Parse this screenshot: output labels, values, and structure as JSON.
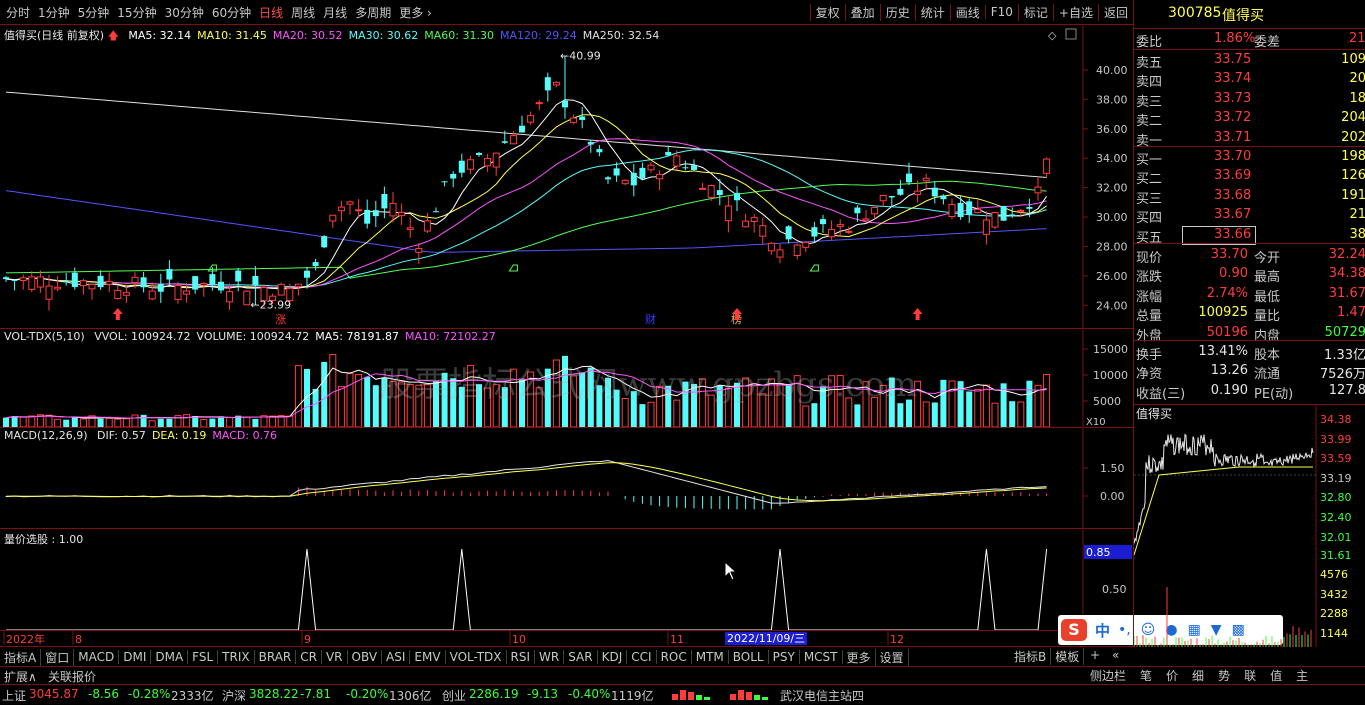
{
  "toolbar": {
    "periods": [
      "分时",
      "1分钟",
      "5分钟",
      "15分钟",
      "30分钟",
      "60分钟",
      "日线",
      "周线",
      "月线",
      "多周期",
      "更多"
    ],
    "active_period": "日线",
    "right_buttons": [
      "复权",
      "叠加",
      "历史",
      "统计",
      "画线",
      "F10",
      "标记",
      "+自选",
      "返回"
    ]
  },
  "main_chart": {
    "title": "值得买(日线 前复权)",
    "ma_labels": [
      {
        "text": "MA5: 32.14",
        "color": "#ffffff"
      },
      {
        "text": "MA10: 31.45",
        "color": "#ffff54"
      },
      {
        "text": "MA20: 30.52",
        "color": "#ff54ff"
      },
      {
        "text": "MA30: 30.62",
        "color": "#54fcfc"
      },
      {
        "text": "MA60: 31.30",
        "color": "#54fc54"
      },
      {
        "text": "MA120: 29.24",
        "color": "#5454fc"
      },
      {
        "text": "MA250: 32.54",
        "color": "#e0e0e0"
      }
    ],
    "y_ticks": [
      "40.00",
      "38.00",
      "36.00",
      "34.00",
      "32.00",
      "30.00",
      "28.00",
      "26.00",
      "24.00"
    ],
    "high_label": "40.99",
    "low_label": "23.99",
    "markers": [
      "涨",
      "财",
      "榜"
    ]
  },
  "vol_panel": {
    "title": "VOL-TDX(5,10)",
    "labels": [
      {
        "text": "VVOL: 100924.72",
        "color": "#e6e6e6"
      },
      {
        "text": "VOLUME: 100924.72",
        "color": "#e6e6e6"
      },
      {
        "text": "MA5: 78191.87",
        "color": "#ffffff"
      },
      {
        "text": "MA10: 72102.27",
        "color": "#ff54ff"
      }
    ],
    "y_ticks": [
      "15000",
      "10000",
      "5000"
    ],
    "unit": "X10"
  },
  "macd_panel": {
    "title": "MACD(12,26,9)",
    "labels": [
      {
        "text": "DIF: 0.57",
        "color": "#e6e6e6"
      },
      {
        "text": "DEA: 0.19",
        "color": "#ffff54"
      },
      {
        "text": "MACD: 0.76",
        "color": "#ff54ff"
      }
    ],
    "y_ticks": [
      "1.50",
      "0.00"
    ]
  },
  "select_panel": {
    "title": "量价选股 : 1.00",
    "y_ticks": [
      "0.85",
      "0.50"
    ]
  },
  "x_axis": {
    "labels": [
      "2022年",
      "8",
      "9",
      "10",
      "11",
      "12"
    ],
    "cursor_label": "2022/11/09/三"
  },
  "watermark": "股票指标公式网www.gpzbgs.com",
  "quote": {
    "code": "300785",
    "name": "值得买",
    "weibi_label": "委比",
    "weibi": "1.86%",
    "weicha_label": "委差",
    "weicha": "21",
    "sells": [
      {
        "label": "卖五",
        "price": "33.75",
        "vol": "109"
      },
      {
        "label": "卖四",
        "price": "33.74",
        "vol": "20"
      },
      {
        "label": "卖三",
        "price": "33.73",
        "vol": "18"
      },
      {
        "label": "卖二",
        "price": "33.72",
        "vol": "204"
      },
      {
        "label": "卖一",
        "price": "33.71",
        "vol": "202"
      }
    ],
    "buys": [
      {
        "label": "买一",
        "price": "33.70",
        "vol": "198"
      },
      {
        "label": "买二",
        "price": "33.69",
        "vol": "126"
      },
      {
        "label": "买三",
        "price": "33.68",
        "vol": "191"
      },
      {
        "label": "买四",
        "price": "33.67",
        "vol": "21"
      },
      {
        "label": "买五",
        "price": "33.66",
        "vol": "38"
      }
    ],
    "stats": [
      {
        "l1": "现价",
        "v1": "33.70",
        "l2": "今开",
        "v2": "32.24"
      },
      {
        "l1": "涨跌",
        "v1": "0.90",
        "l2": "最高",
        "v2": "34.38"
      },
      {
        "l1": "涨幅",
        "v1": "2.74%",
        "l2": "最低",
        "v2": "31.67"
      },
      {
        "l1": "总量",
        "v1": "100925",
        "l2": "量比",
        "v2": "1.47"
      },
      {
        "l1": "外盘",
        "v1": "50196",
        "l2": "内盘",
        "v2": "50729"
      }
    ],
    "stats2": [
      {
        "l1": "换手",
        "v1": "13.41%",
        "l2": "股本",
        "v2": "1.33亿"
      },
      {
        "l1": "净资",
        "v1": "13.26",
        "l2": "流通",
        "v2": "7526万"
      },
      {
        "l1": "收益(三)",
        "v1": "0.190",
        "l2": "PE(动)",
        "v2": "127.8"
      }
    ],
    "mini_title": "值得买",
    "mini_ticks": [
      "34.38",
      "33.99",
      "33.59",
      "33.19",
      "32.80",
      "32.40",
      "32.01",
      "31.61",
      "4576",
      "3432",
      "2288",
      "1144"
    ]
  },
  "tabs": [
    "指标A",
    "窗口",
    "MACD",
    "DMI",
    "DMA",
    "FSL",
    "TRIX",
    "BRAR",
    "CR",
    "VR",
    "OBV",
    "ASI",
    "EMV",
    "VOL-TDX",
    "RSI",
    "WR",
    "SAR",
    "KDJ",
    "CCI",
    "ROC",
    "MTM",
    "BOLL",
    "PSY",
    "MCST",
    "更多",
    "设置"
  ],
  "tabs_right": [
    "指标B",
    "模板"
  ],
  "row2": {
    "left1": "扩展∧",
    "left2": "关联报价"
  },
  "side_tabs": [
    "侧边栏",
    "笔",
    "价",
    "细",
    "势",
    "联",
    "值",
    "主"
  ],
  "status": {
    "sh_label": "上证",
    "sh_val": "3045.87",
    "sh_chg": "-8.56",
    "sh_pct": "-0.28%",
    "sh_amt": "2333亿",
    "sz_label": "沪深",
    "sz_val": "3828.22",
    "sz_chg": "-7.81",
    "sz_pct": "-0.20%",
    "sz_amt": "1306亿",
    "cy_label": "创业",
    "cy_val": "2286.19",
    "cy_chg": "-9.13",
    "cy_pct": "-0.40%",
    "cy_amt": "1119亿",
    "server": "武汉电信主站四"
  },
  "ime": {
    "lang": "中"
  }
}
